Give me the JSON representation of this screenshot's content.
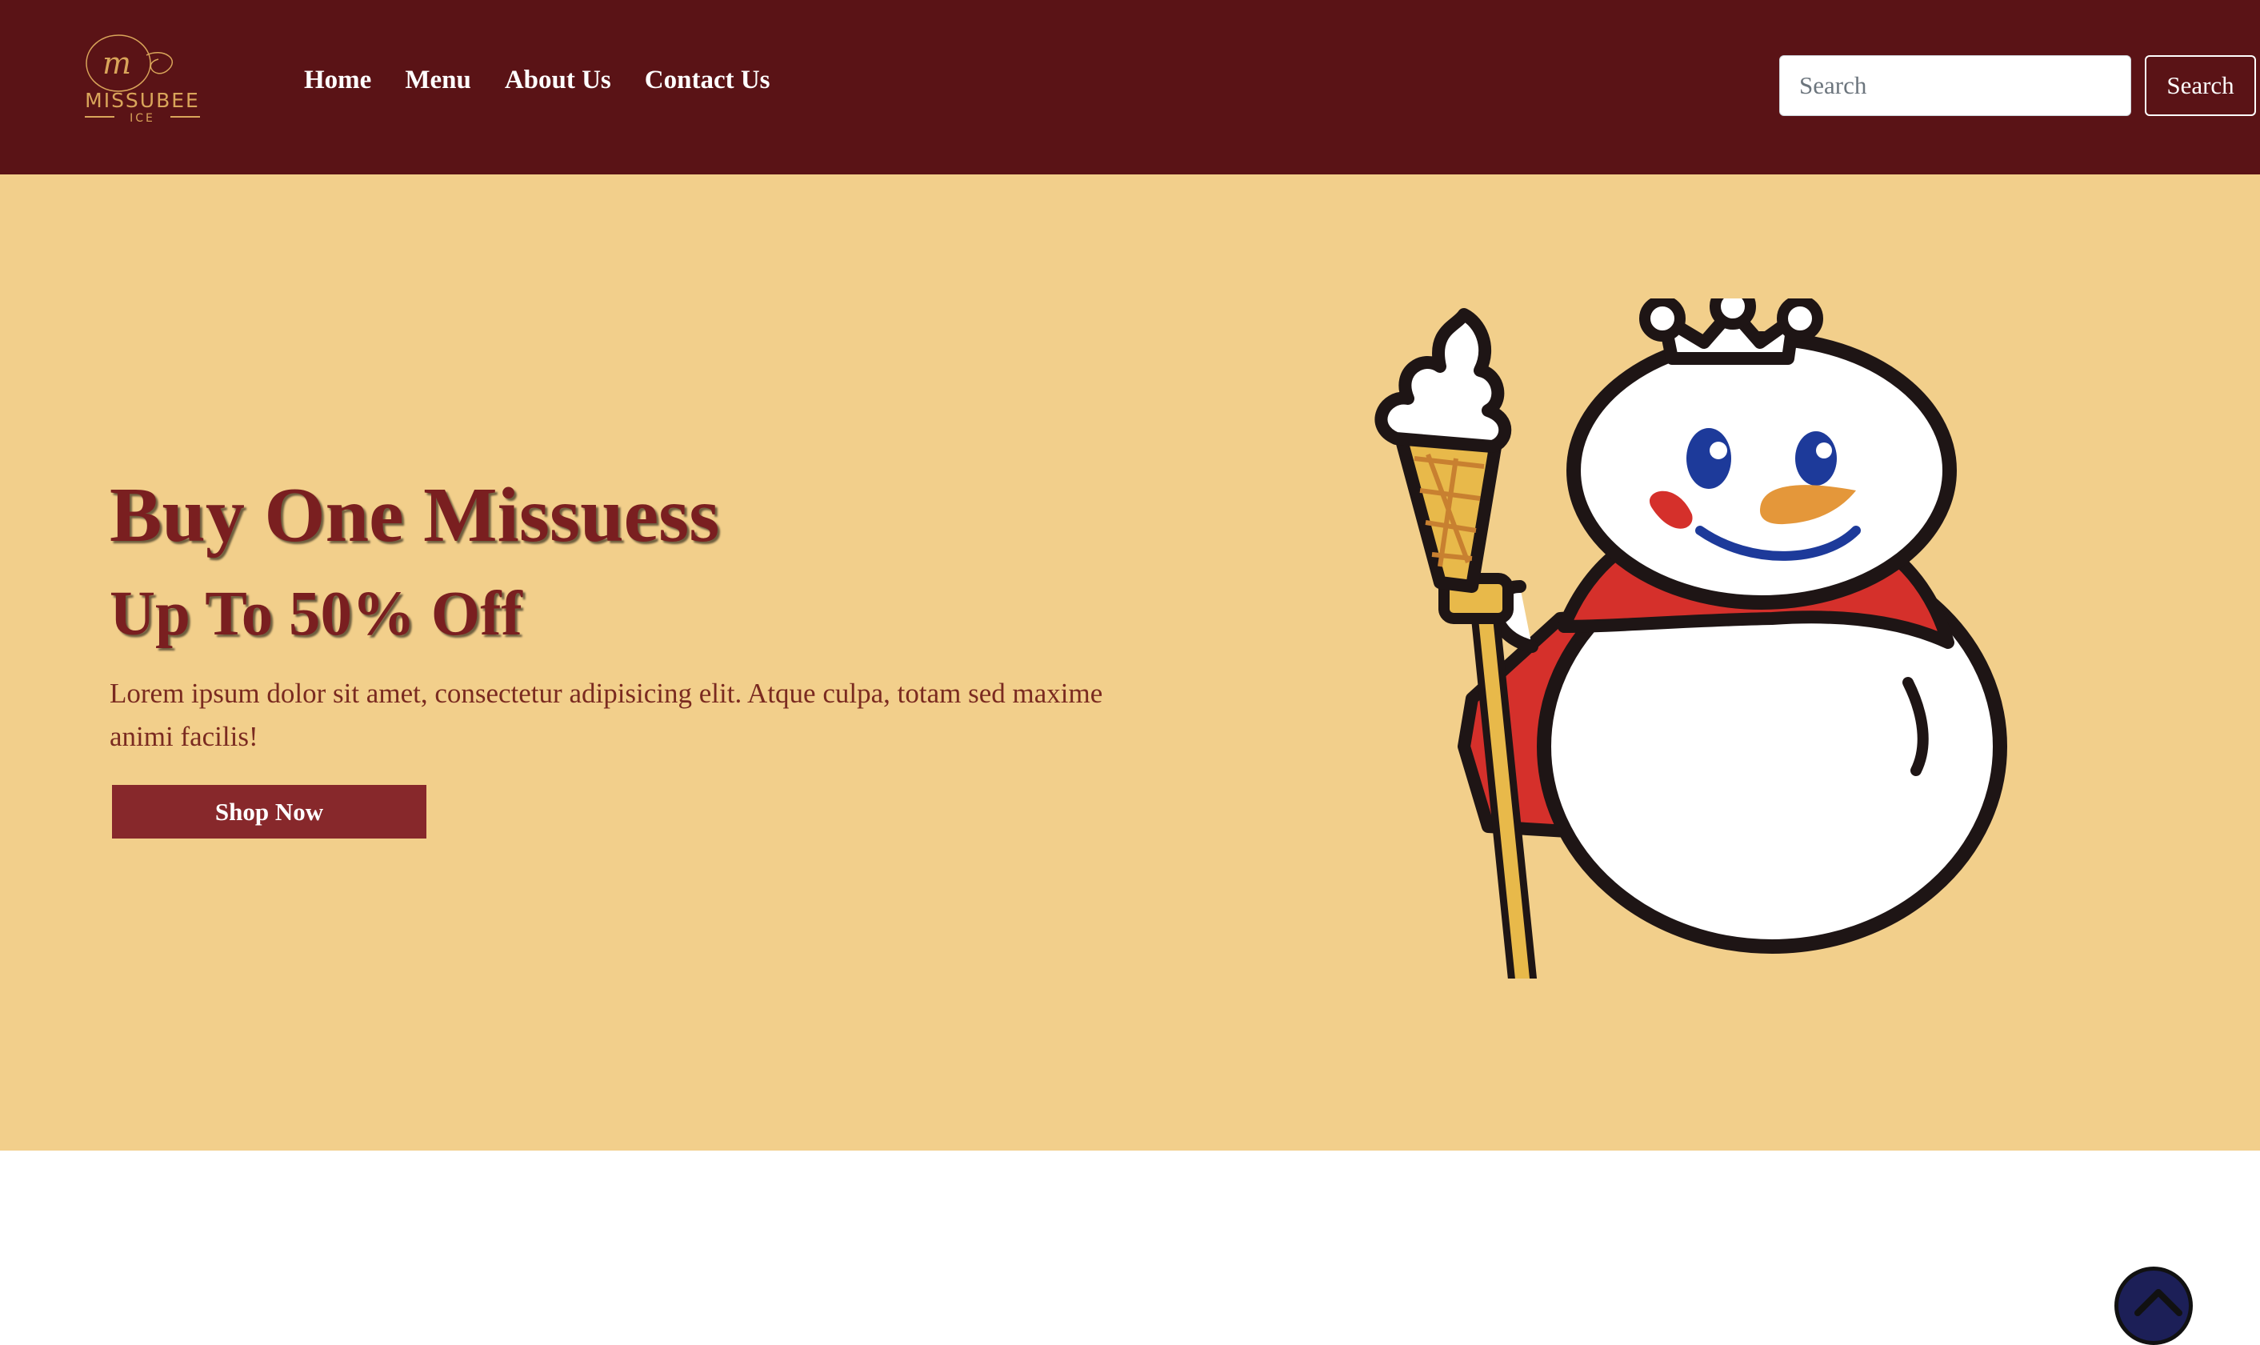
{
  "brand": {
    "logo_text": "MISSUBEE",
    "logo_sub": "ICE",
    "logo_mark": "m",
    "logo_color": "#d9a55a"
  },
  "nav": {
    "items": [
      {
        "label": "Home"
      },
      {
        "label": "Menu"
      },
      {
        "label": "About Us"
      },
      {
        "label": "Contact Us"
      }
    ]
  },
  "search": {
    "placeholder": "Search",
    "value": "",
    "button_label": "Search"
  },
  "hero": {
    "title": "Buy One Missuess",
    "subtitle": "Up To 50% Off",
    "text": "Lorem ipsum dolor sit amet, consectetur adipisicing elit. Atque culpa, totam sed maxime animi facilis!",
    "cta_label": "Shop Now",
    "mascot_icon": "snowman-king-ice-cream-icon"
  },
  "scroll_top": {
    "icon": "chevron-up-icon"
  },
  "colors": {
    "navbar_bg": "#5a1316",
    "hero_bg": "#f2cf8b",
    "heading": "#7a1f20",
    "cta_bg": "#87282b",
    "scroll_top_bg": "#1c1f57"
  }
}
